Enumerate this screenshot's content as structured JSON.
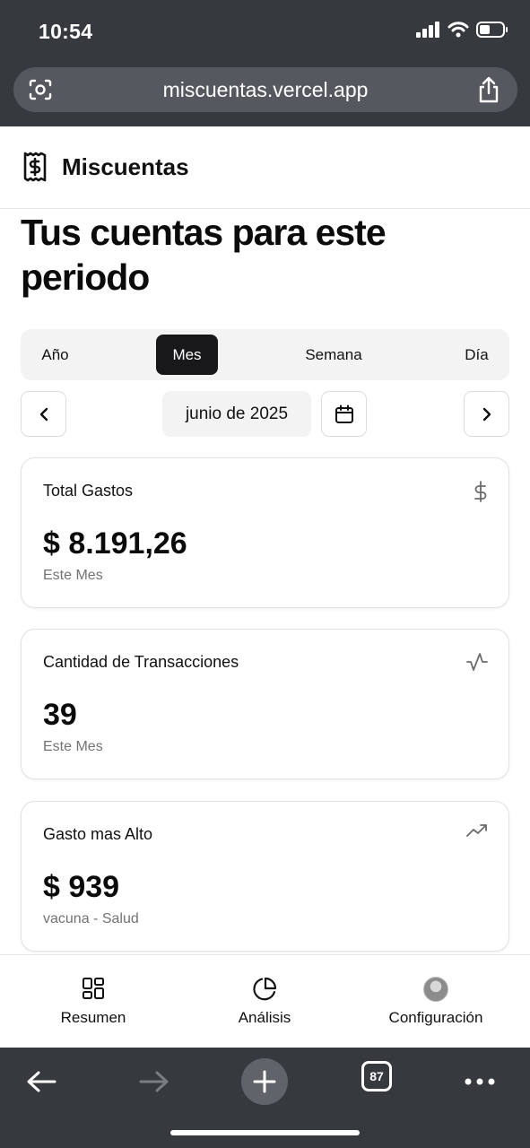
{
  "status_bar": {
    "time": "10:54"
  },
  "browser": {
    "url": "miscuentas.vercel.app",
    "tab_count": "87"
  },
  "header": {
    "app_name": "Miscuentas"
  },
  "page": {
    "title": "Tus cuentas para este periodo"
  },
  "period_tabs": [
    {
      "label": "Año",
      "active": false
    },
    {
      "label": "Mes",
      "active": true
    },
    {
      "label": "Semana",
      "active": false
    },
    {
      "label": "Día",
      "active": false
    }
  ],
  "date_nav": {
    "current": "junio de 2025"
  },
  "cards": [
    {
      "title": "Total Gastos",
      "value": "$ 8.191,26",
      "subtitle": "Este Mes",
      "icon": "dollar-icon"
    },
    {
      "title": "Cantidad de Transacciones",
      "value": "39",
      "subtitle": "Este Mes",
      "icon": "activity-icon"
    },
    {
      "title": "Gasto mas Alto",
      "value": "$ 939",
      "subtitle": "vacuna - Salud",
      "icon": "trending-up-icon"
    }
  ],
  "bottom_nav": [
    {
      "label": "Resumen",
      "icon": "grid-icon"
    },
    {
      "label": "Análisis",
      "icon": "pie-chart-icon"
    },
    {
      "label": "Configuración",
      "icon": "avatar"
    }
  ],
  "colors": {
    "chrome": "#36393d",
    "active_tab": "#18181b",
    "muted_text": "#737373",
    "card_border": "#e2e2e5"
  }
}
